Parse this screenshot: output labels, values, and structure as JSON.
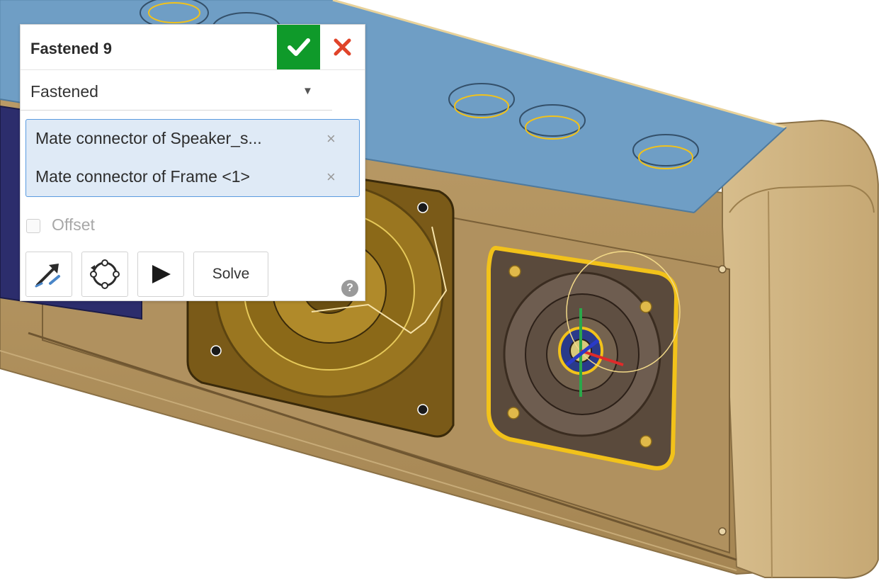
{
  "dialog": {
    "title": "Fastened 9",
    "mate_type": "Fastened",
    "selections": [
      {
        "label": "Mate connector of Speaker_s...",
        "remove": "×"
      },
      {
        "label": "Mate connector of Frame <1>",
        "remove": "×"
      }
    ],
    "offset_label": "Offset",
    "offset_checked": false,
    "solve_label": "Solve",
    "help": "?"
  },
  "icons": {
    "accept": "checkmark-icon",
    "cancel": "close-x-icon",
    "caret": "chevron-down-icon",
    "tool_1": "flip-direction-arrow-icon",
    "tool_2": "reorient-rotate-icon",
    "tool_3": "play-animate-icon",
    "help": "help-question-icon"
  },
  "colors": {
    "accept_green": "#0f9a2a",
    "cancel_red": "#e0442a",
    "selection_bg": "#dfeaf6",
    "selection_border": "#5a9be0",
    "model_body": "#c4a470",
    "model_top": "#6f9ec5",
    "highlight_yellow": "#f2c21a"
  }
}
